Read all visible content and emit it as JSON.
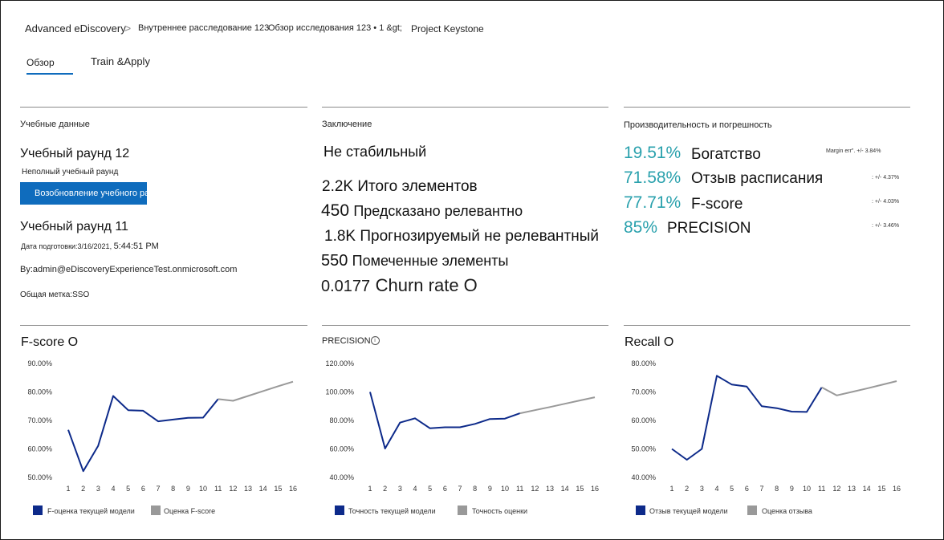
{
  "breadcrumb": {
    "root": "Advanced eDiscovery",
    "sep": ">",
    "case": "Внутреннее расследование 123",
    "review": "Обзор исследования 123 • 1 &gt;",
    "project": "Project Keystone"
  },
  "tabs": [
    {
      "label": "Обзор",
      "active": true
    },
    {
      "label": "Train &Apply",
      "active": false
    }
  ],
  "training": {
    "section_title": "Учебные данные",
    "round12_title": "Учебный раунд 12",
    "round12_status": "Неполный учебный раунд",
    "resume_button": "Возобновление учебного раунда",
    "round11_title": "Учебный раунд 11",
    "prep_date_label": "Дата подготовки:3/16/2021, ",
    "prep_time": "5:44:51 PM",
    "by": "By:admin@eDiscoveryExperienceTest.onmicrosoft.com",
    "label": "Общая метка:SSO"
  },
  "conclusion": {
    "section_title": "Заключение",
    "status": "Не стабильный",
    "total": {
      "value": "2.2K",
      "label": "Итого элементов"
    },
    "relevant": {
      "value": "450",
      "label": "Предсказано релевантно"
    },
    "not_relevant": {
      "value": "1.8K",
      "label": "Прогнозируемый не релевантный"
    },
    "tagged": {
      "value": "550",
      "label": "Помеченные элементы"
    },
    "churn": {
      "value": "0.0177",
      "label": "Churn rate O"
    }
  },
  "performance": {
    "section_title": "Производительность и погрешность",
    "margin_label": "Margin err\". +/- 3.84%",
    "metrics": [
      {
        "value": "19.51%",
        "label": "Богатство",
        "err": ""
      },
      {
        "value": "71.58%",
        "label": "Отзыв расписания",
        "err": ": +/- 4.37%"
      },
      {
        "value": "77.71%",
        "label": "F-score",
        "err": ": +/- 4.03%"
      },
      {
        "value": "85%",
        "label": "PRECISION",
        "err": ": +/- 3.46%"
      }
    ]
  },
  "colors": {
    "current": "#0d2a8a",
    "estimate": "#999999",
    "accent": "#0f6cbd",
    "teal": "#2aa1ad"
  },
  "chart_data": [
    {
      "type": "line",
      "title": "F-score O",
      "x": [
        1,
        2,
        3,
        4,
        5,
        6,
        7,
        8,
        9,
        10,
        11,
        12,
        13,
        14,
        15,
        16
      ],
      "yticks": [
        "90.00%",
        "80.00%",
        "70.00%",
        "60.00%",
        "50.00%"
      ],
      "ylim": [
        50,
        90
      ],
      "series": [
        {
          "name": "F-оценка текущей модели",
          "color": "#0d2a8a",
          "x": [
            1,
            2,
            3,
            4,
            5,
            6,
            7,
            8,
            9,
            10,
            11
          ],
          "values": [
            66.7,
            52.2,
            61.1,
            78.6,
            73.6,
            73.4,
            69.7,
            70.3,
            70.9,
            71.0,
            77.5
          ]
        },
        {
          "name": "Оценка F-score",
          "color": "#999999",
          "x": [
            11,
            12,
            13,
            14,
            15,
            16
          ],
          "values": [
            77.5,
            76.9,
            78.6,
            80.3,
            82.0,
            83.6
          ]
        }
      ],
      "grid": false,
      "legend": "bottom-left"
    },
    {
      "type": "line",
      "title": "PRECISION",
      "x": [
        1,
        2,
        3,
        4,
        5,
        6,
        7,
        8,
        9,
        10,
        11,
        12,
        13,
        14,
        15,
        16
      ],
      "yticks": [
        "120.00%",
        "100.00%",
        "80.00%",
        "60.00%",
        "40.00%"
      ],
      "ylim": [
        40,
        120
      ],
      "series": [
        {
          "name": "Точность текущей модели",
          "color": "#0d2a8a",
          "x": [
            1,
            2,
            3,
            4,
            5,
            6,
            7,
            8,
            9,
            10,
            11
          ],
          "values": [
            100,
            60.3,
            78.5,
            81.5,
            74.5,
            75.2,
            75.2,
            77.6,
            81.0,
            81.3,
            85.0
          ]
        },
        {
          "name": "Точность оценки",
          "color": "#999999",
          "x": [
            11,
            12,
            13,
            14,
            15,
            16
          ],
          "values": [
            85.0,
            87.2,
            89.4,
            91.7,
            94.0,
            96.3
          ]
        }
      ],
      "grid": false,
      "legend": "bottom-left"
    },
    {
      "type": "line",
      "title": "Recall O",
      "x": [
        1,
        2,
        3,
        4,
        5,
        6,
        7,
        8,
        9,
        10,
        11,
        12,
        13,
        14,
        15,
        16
      ],
      "yticks": [
        "80.00%",
        "70.00%",
        "60.00%",
        "50.00%",
        "40.00%"
      ],
      "ylim": [
        40,
        80
      ],
      "series": [
        {
          "name": "Отзыв текущей модели",
          "color": "#0d2a8a",
          "x": [
            1,
            2,
            3,
            4,
            5,
            6,
            7,
            8,
            9,
            10,
            11
          ],
          "values": [
            50.0,
            46.2,
            50.0,
            75.7,
            72.6,
            71.9,
            65.0,
            64.3,
            63.1,
            63.0,
            71.6
          ]
        },
        {
          "name": "Оценка отзыва",
          "color": "#999999",
          "x": [
            11,
            12,
            13,
            14,
            15,
            16
          ],
          "values": [
            71.6,
            68.8,
            70.0,
            71.2,
            72.5,
            73.8
          ]
        }
      ],
      "grid": false,
      "legend": "bottom-left"
    }
  ]
}
